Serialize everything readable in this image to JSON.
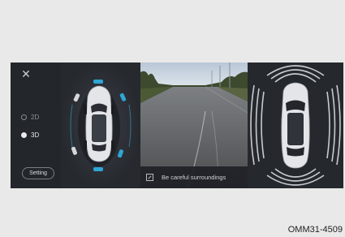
{
  "panel": {
    "close_icon": "close-icon",
    "modes": [
      {
        "label": "2D",
        "selected": false
      },
      {
        "label": "3D",
        "selected": true
      }
    ],
    "setting_label": "Setting"
  },
  "camera": {
    "warning_text": "Be careful surroundings",
    "warning_icon": "expand-icon"
  },
  "sensor_color": "#2ea6d6",
  "caption": "OMM31-4509"
}
